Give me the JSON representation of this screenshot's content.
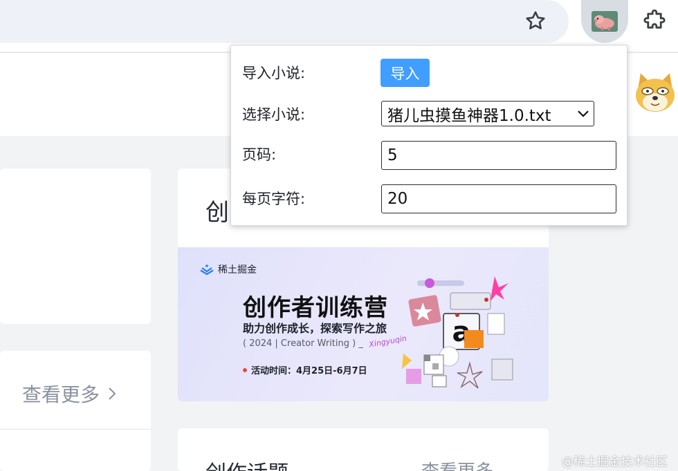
{
  "browser": {
    "icons": {
      "bookmark": "star-outline-icon",
      "extension": "pig-avatar-icon",
      "extensions_menu": "puzzle-piece-icon"
    }
  },
  "popup": {
    "import_label": "导入小说:",
    "import_button": "导入",
    "select_label": "选择小说:",
    "selected_novel": "猪儿虫摸鱼神器1.0.txt",
    "page_label": "页码:",
    "page_value": "5",
    "chars_label": "每页字符:",
    "chars_value": "20",
    "accent": "#409eff"
  },
  "page": {
    "view_more": "查看更多",
    "creation_card_title_peek": "创",
    "topics_title": "创作话题",
    "topics_more": "查看更多",
    "watermark": "@稀土掘金技术社区",
    "banner": {
      "brand": "稀土掘金",
      "title": "创作者训练营",
      "subtitle": "助力创作成长，探索写作之旅",
      "note": "( 2024 | Creator Writing ) _",
      "script_text": "Xingyuqin",
      "date": "活动时间：4月25日-6月7日"
    }
  }
}
